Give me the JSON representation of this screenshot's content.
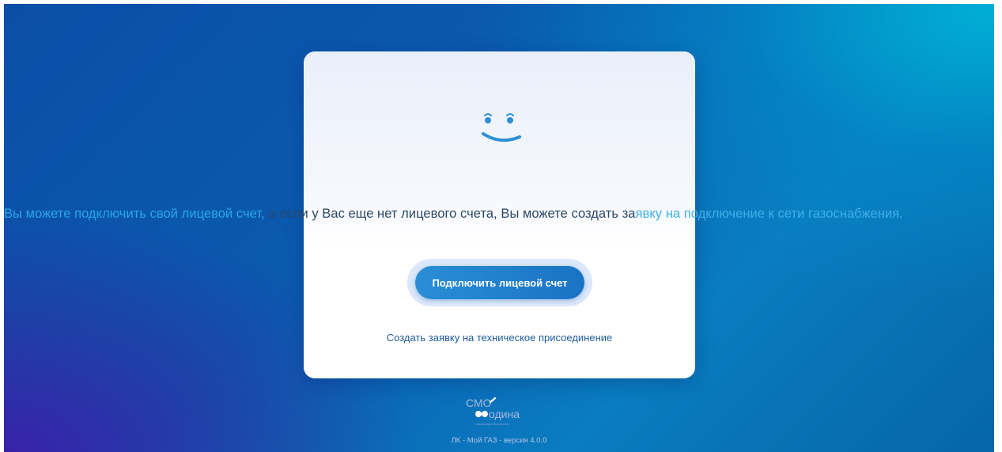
{
  "message": {
    "part1": "Вы можете подключить свой лицевой счет, ",
    "part2": "а если у Вас еще нет лицевого счета, Вы можете создать за",
    "part3": "явку на подключение к сети газоснабжения."
  },
  "actions": {
    "connect_account_label": "Подключить лицевой счет",
    "tech_connection_link": "Создать заявку на техническое присоединение"
  },
  "logo": {
    "line1": "СМО",
    "line2": "одина",
    "tagline": "газораспределительная сеть"
  },
  "footer": {
    "version": "ЛК - Мой ГАЗ - версия 4.0.0"
  },
  "colors": {
    "accent": "#1a73c4",
    "link": "#1e5c9a",
    "smiley": "#2f8fd6"
  }
}
